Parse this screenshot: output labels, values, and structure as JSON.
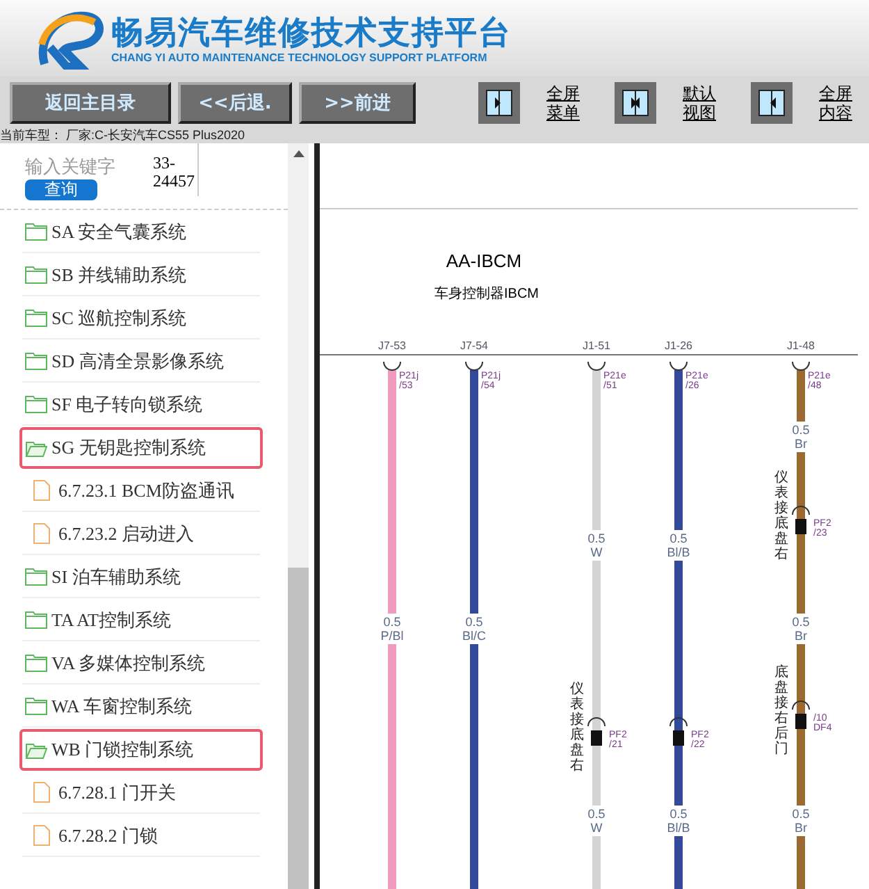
{
  "header": {
    "title": "畅易汽车维修技术支持平台",
    "subtitle": "CHANG YI AUTO MAINTENANCE TECHNOLOGY SUPPORT PLATFORM"
  },
  "toolbar": {
    "buttons": [
      "返回主目录",
      "<<后退.",
      ">>前进"
    ],
    "view_buttons": [
      {
        "kind": "menu",
        "label": "全屏菜单"
      },
      {
        "kind": "default",
        "label": "默认视图"
      },
      {
        "kind": "content",
        "label": "全屏内容"
      }
    ]
  },
  "current_model": "当前车型：  厂家:C-长安汽车CS55 Plus2020",
  "search": {
    "placeholder": "输入关键字",
    "button": "查询",
    "code": "33-24457"
  },
  "tree": [
    {
      "label": "SA 安全气囊系统",
      "expanded": false,
      "selected": false
    },
    {
      "label": "SB 并线辅助系统",
      "expanded": false,
      "selected": false
    },
    {
      "label": "SC 巡航控制系统",
      "expanded": false,
      "selected": false
    },
    {
      "label": "SD 高清全景影像系统",
      "expanded": false,
      "selected": false
    },
    {
      "label": "SF 电子转向锁系统",
      "expanded": false,
      "selected": false
    },
    {
      "label": "SG 无钥匙控制系统",
      "expanded": true,
      "selected": true,
      "children": [
        {
          "label": "6.7.23.1 BCM防盗通讯",
          "selected": false
        },
        {
          "label": "6.7.23.2 启动进入",
          "selected": false
        }
      ]
    },
    {
      "label": "SI 泊车辅助系统",
      "expanded": false,
      "selected": false
    },
    {
      "label": "TA AT控制系统",
      "expanded": false,
      "selected": false
    },
    {
      "label": "VA 多媒体控制系统",
      "expanded": false,
      "selected": false
    },
    {
      "label": "WA 车窗控制系统",
      "expanded": false,
      "selected": false
    },
    {
      "label": "WB 门锁控制系统",
      "expanded": true,
      "selected": true,
      "children": [
        {
          "label": "6.7.28.1 门开关",
          "selected": false
        },
        {
          "label": "6.7.28.2 门锁",
          "selected": false
        }
      ]
    }
  ],
  "diagram": {
    "module": "AA-IBCM",
    "module_name": "车身控制器IBCM",
    "wires": [
      {
        "pin": "J7-53",
        "connector": "P21j",
        "terminal": "/53",
        "color": "#f19ac0",
        "items": [
          {
            "kind": "gauge",
            "size": "0.5",
            "code": "P/Bl"
          }
        ]
      },
      {
        "pin": "J7-54",
        "connector": "P21j",
        "terminal": "/54",
        "color": "#34499a",
        "items": [
          {
            "kind": "gauge",
            "size": "0.5",
            "code": "Bl/C"
          }
        ]
      },
      {
        "pin": "J1-51",
        "connector": "P21e",
        "terminal": "/51",
        "color": "#d4d4d4",
        "items": [
          {
            "kind": "gauge",
            "size": "0.5",
            "code": "W"
          },
          {
            "kind": "splice",
            "connector": "PF2",
            "terminal": "/21",
            "note": "仪表接底盘右"
          },
          {
            "kind": "gauge",
            "size": "0.5",
            "code": "W"
          }
        ]
      },
      {
        "pin": "J1-26",
        "connector": "P21e",
        "terminal": "/26",
        "color": "#34499a",
        "items": [
          {
            "kind": "gauge",
            "size": "0.5",
            "code": "Bl/B"
          },
          {
            "kind": "splice",
            "connector": "PF2",
            "terminal": "/22"
          },
          {
            "kind": "gauge",
            "size": "0.5",
            "code": "Bl/B"
          }
        ]
      },
      {
        "pin": "J1-48",
        "connector": "P21e",
        "terminal": "/48",
        "color": "#9a6a30",
        "items": [
          {
            "kind": "gauge",
            "size": "0.5",
            "code": "Br"
          },
          {
            "kind": "splice",
            "connector": "PF2",
            "terminal": "/23",
            "note": "仪表接底盘右"
          },
          {
            "kind": "gauge",
            "size": "0.5",
            "code": "Br"
          },
          {
            "kind": "splice",
            "connector": "/10",
            "terminal": "DF4",
            "note": "底盘接右后门"
          },
          {
            "kind": "gauge",
            "size": "0.5",
            "code": "Br"
          }
        ]
      }
    ]
  }
}
